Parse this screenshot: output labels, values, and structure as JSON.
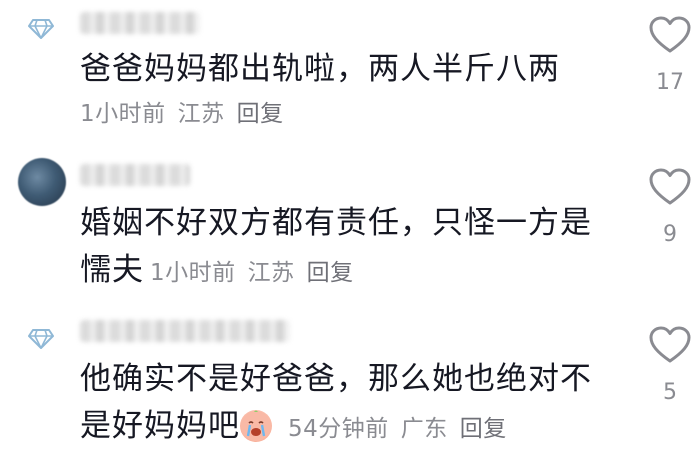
{
  "comments": [
    {
      "text": "爸爸妈妈都出轨啦，两人半斤八两",
      "time": "1小时前",
      "location": "江苏",
      "reply": "回复",
      "likes": "17",
      "avatar": "diamond-icon"
    },
    {
      "text": "婚姻不好双方都有责任，只怪一方是",
      "text_cont": "懦夫",
      "time": "1小时前",
      "location": "江苏",
      "reply": "回复",
      "likes": "9",
      "avatar": "blurred-avatar"
    },
    {
      "text": "他确实不是好爸爸，那么她也绝对不",
      "text_cont": "是好妈妈吧",
      "emoji": "crying-emoji",
      "time": "54分钟前",
      "location": "广东",
      "reply": "回复",
      "likes": "5",
      "avatar": "diamond-icon"
    }
  ],
  "colors": {
    "text": "#161823",
    "meta": "#8a8b91",
    "icon_stroke": "#8a8b91"
  }
}
